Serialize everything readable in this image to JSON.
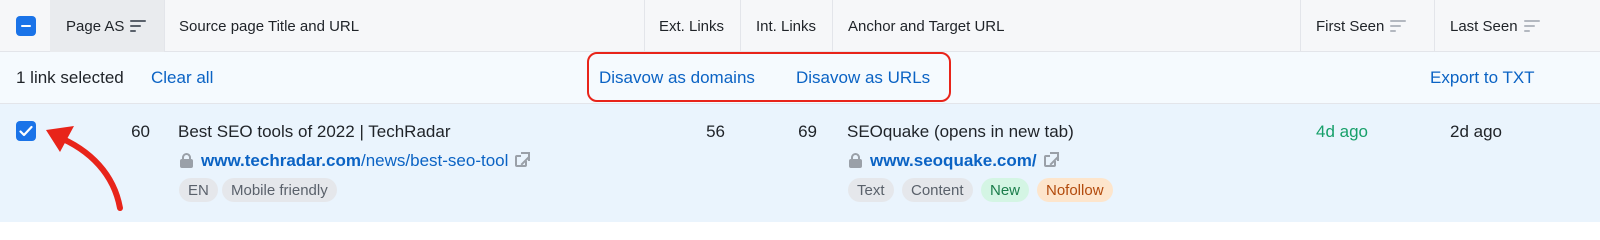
{
  "header": {
    "page_as": "Page AS",
    "source": "Source page Title and URL",
    "ext_links": "Ext. Links",
    "int_links": "Int. Links",
    "anchor": "Anchor and Target URL",
    "first_seen": "First Seen",
    "last_seen": "Last Seen"
  },
  "selection_bar": {
    "count_text": "1 link selected",
    "clear_all": "Clear all",
    "disavow_domains": "Disavow as domains",
    "disavow_urls": "Disavow as URLs",
    "export": "Export to TXT"
  },
  "row": {
    "checked": true,
    "page_as": "60",
    "source_title": "Best SEO tools of 2022 | TechRadar",
    "source_url_domain": "www.techradar.com",
    "source_url_path": "/news/best-seo-tool",
    "ext_links": "56",
    "int_links": "69",
    "anchor_text": "SEOquake (opens in new tab)",
    "target_url": "www.seoquake.com/",
    "first_seen": "4d ago",
    "last_seen": "2d ago",
    "source_tags": [
      "EN",
      "Mobile friendly"
    ],
    "target_tags": [
      "Text",
      "Content",
      "New",
      "Nofollow"
    ]
  },
  "colors": {
    "accent": "#1a73e8",
    "link": "#0b63c4",
    "first_seen": "#17a06a",
    "annotation": "#e8241a",
    "tag_new_bg": "#d4f5e4",
    "tag_nofollow_bg": "#fde5cc"
  }
}
